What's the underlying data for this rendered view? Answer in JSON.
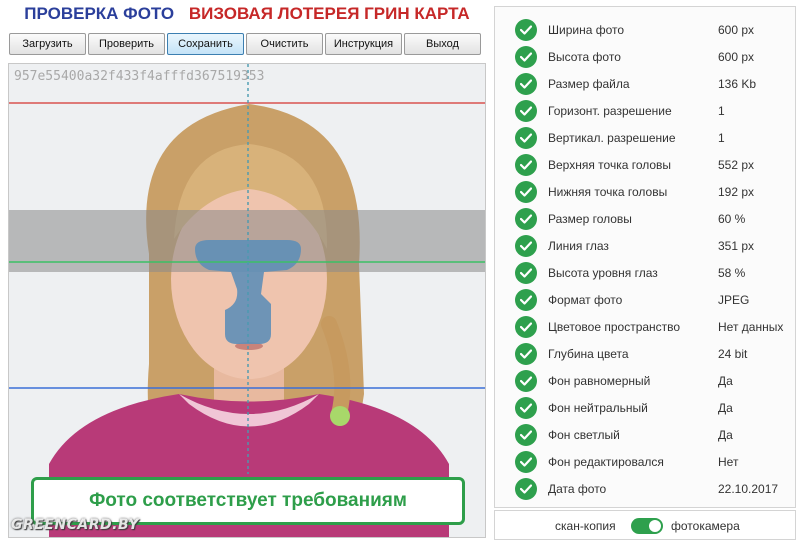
{
  "header": {
    "title_left": "ПРОВЕРКА ФОТО",
    "title_right": "ВИЗОВАЯ ЛОТЕРЕЯ ГРИН КАРТА"
  },
  "toolbar": {
    "buttons": [
      {
        "label": "Загрузить"
      },
      {
        "label": "Проверить"
      },
      {
        "label": "Сохранить",
        "active": true
      },
      {
        "label": "Очистить"
      },
      {
        "label": "Инструкция"
      },
      {
        "label": "Выход"
      }
    ]
  },
  "photo": {
    "hash": "957e55400a32f433f4afffd367519353",
    "verdict": "Фото соответствует требованиям"
  },
  "watermark": "GREENCARD.BY",
  "checks": [
    {
      "label": "Ширина фото",
      "value": "600 px"
    },
    {
      "label": "Высота фото",
      "value": "600 px"
    },
    {
      "label": "Размер файла",
      "value": "136 Kb"
    },
    {
      "label": "Горизонт. разрешение",
      "value": "1"
    },
    {
      "label": "Вертикал. разрешение",
      "value": "1"
    },
    {
      "label": "Верхняя точка головы",
      "value": "552 px"
    },
    {
      "label": "Нижняя точка головы",
      "value": "192 px"
    },
    {
      "label": "Размер головы",
      "value": "60 %"
    },
    {
      "label": "Линия глаз",
      "value": "351 px"
    },
    {
      "label": "Высота уровня глаз",
      "value": "58 %"
    },
    {
      "label": "Формат фото",
      "value": "JPEG"
    },
    {
      "label": "Цветовое пространство",
      "value": "Нет данных"
    },
    {
      "label": "Глубина цвета",
      "value": "24 bit"
    },
    {
      "label": "Фон равномерный",
      "value": "Да"
    },
    {
      "label": "Фон нейтральный",
      "value": "Да"
    },
    {
      "label": "Фон светлый",
      "value": "Да"
    },
    {
      "label": "Фон редактировался",
      "value": "Нет"
    },
    {
      "label": "Дата фото",
      "value": "22.10.2017"
    }
  ],
  "mode": {
    "left_label": "скан-копия",
    "right_label": "фотокамера",
    "selected": "фотокамера"
  },
  "colors": {
    "accent_green": "#2ea04d",
    "title_blue": "#2b3f9b",
    "title_red": "#c62828",
    "guide_top": "#d9534f",
    "guide_eye": "#3cc066",
    "guide_chin": "#3a6fd8",
    "guide_center": "#4a9ab0"
  }
}
